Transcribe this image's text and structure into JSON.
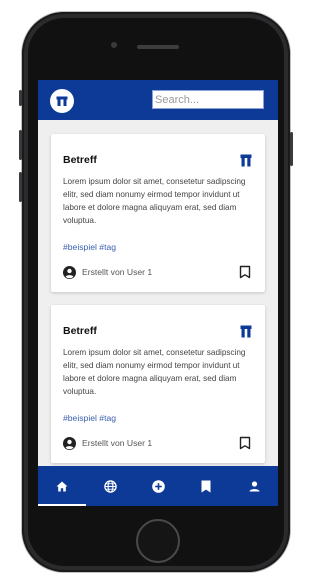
{
  "search": {
    "placeholder": "Search..."
  },
  "posts": [
    {
      "title": "Betreff",
      "body": "Lorem ipsum dolor sit amet, consetetur sadipscing elitr, sed diam nonumy eirmod tempor invidunt ut labore et dolore magna aliquyam erat, sed diam voluptua.",
      "tags": "#beispiel #tag",
      "author": "Erstellt von User 1"
    },
    {
      "title": "Betreff",
      "body": "Lorem ipsum dolor sit amet, consetetur sadipscing elitr, sed diam nonumy eirmod tempor invidunt ut labore et dolore magna aliquyam erat, sed diam voluptua.",
      "tags": "#beispiel #tag",
      "author": "Erstellt von User 1"
    }
  ],
  "bottom_nav": {
    "items": [
      {
        "icon": "home-icon",
        "active": true
      },
      {
        "icon": "globe-icon",
        "active": false
      },
      {
        "icon": "add-circle-icon",
        "active": false
      },
      {
        "icon": "bookmark-icon",
        "active": false
      },
      {
        "icon": "person-icon",
        "active": false
      }
    ]
  },
  "colors": {
    "brand": "#0d3a96",
    "tag_link": "#3a5fb0",
    "phone_frame": "#2b2b2d",
    "screen_background": "#efefef"
  }
}
